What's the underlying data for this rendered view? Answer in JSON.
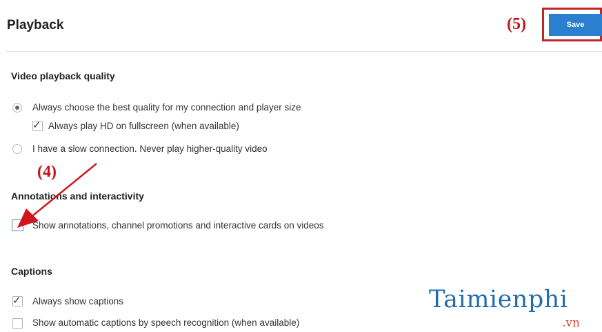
{
  "header": {
    "title": "Playback",
    "save_label": "Save",
    "step_save": "(5)"
  },
  "sections": {
    "quality": {
      "title": "Video playback quality",
      "best_quality_label": "Always choose the best quality for my connection and player size",
      "hd_fullscreen_label": "Always play HD on fullscreen (when available)",
      "slow_connection_label": "I have a slow connection. Never play higher-quality video"
    },
    "annotations": {
      "title": "Annotations and interactivity",
      "show_annotations_label": "Show annotations, channel promotions and interactive cards on videos",
      "step_label": "(4)"
    },
    "captions": {
      "title": "Captions",
      "always_show_label": "Always show captions",
      "automatic_label": "Show automatic captions by speech recognition (when available)"
    }
  },
  "state": {
    "best_quality_selected": true,
    "hd_fullscreen_checked": true,
    "slow_connection_selected": false,
    "show_annotations_checked": false,
    "always_show_captions_checked": true,
    "automatic_captions_checked": false
  },
  "watermark": {
    "logo": "Taimienphi",
    "suffix": ".vn"
  },
  "colors": {
    "accent": "#2a7fcf",
    "annotation_red": "#c0151b",
    "divider": "#e3e3e3"
  },
  "icons": {
    "arrow": "red-arrow-icon",
    "checkmark": "check-icon"
  }
}
